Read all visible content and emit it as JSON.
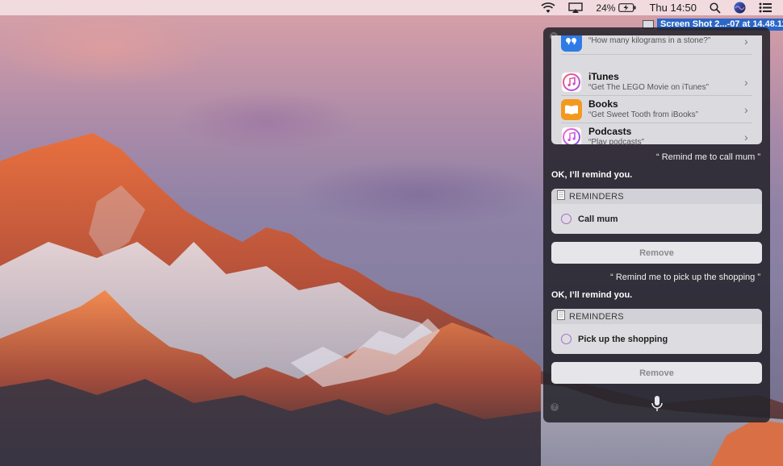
{
  "menubar": {
    "battery_percent": "24%",
    "clock": "Thu 14:50",
    "icons": [
      "wifi-icon",
      "airplay-icon",
      "battery-charging-icon",
      "spotlight-search-icon",
      "siri-icon",
      "notification-center-icon"
    ]
  },
  "screenshot_file": {
    "label": "Screen Shot 2...-07 at 14.48.11"
  },
  "siri": {
    "apps": [
      {
        "name": "",
        "hint": "“How many kilograms in a stone?”",
        "icon": "quotes-app-icon"
      },
      {
        "name": "iTunes",
        "hint": "“Get The LEGO Movie on iTunes”",
        "icon": "itunes-icon"
      },
      {
        "name": "Books",
        "hint": "“Get Sweet Tooth from iBooks”",
        "icon": "books-icon"
      },
      {
        "name": "Podcasts",
        "hint": "“Play podcasts”",
        "icon": "podcasts-icon"
      }
    ],
    "conversation": [
      {
        "user_quote": "“ Remind me to call mum ”",
        "reply": "OK, I’ll remind you.",
        "card_header": "REMINDERS",
        "reminder": "Call mum",
        "button": "Remove"
      },
      {
        "user_quote": "“ Remind me to pick up the shopping ”",
        "reply": "OK, I’ll remind you.",
        "card_header": "REMINDERS",
        "reminder": "Pick up the shopping",
        "button": "Remove"
      }
    ],
    "colors": {
      "panel": "#26242c",
      "card": "#e2e2e6",
      "reminder_circle": "#a76cc4",
      "selection_blue": "#2a67c9"
    }
  }
}
